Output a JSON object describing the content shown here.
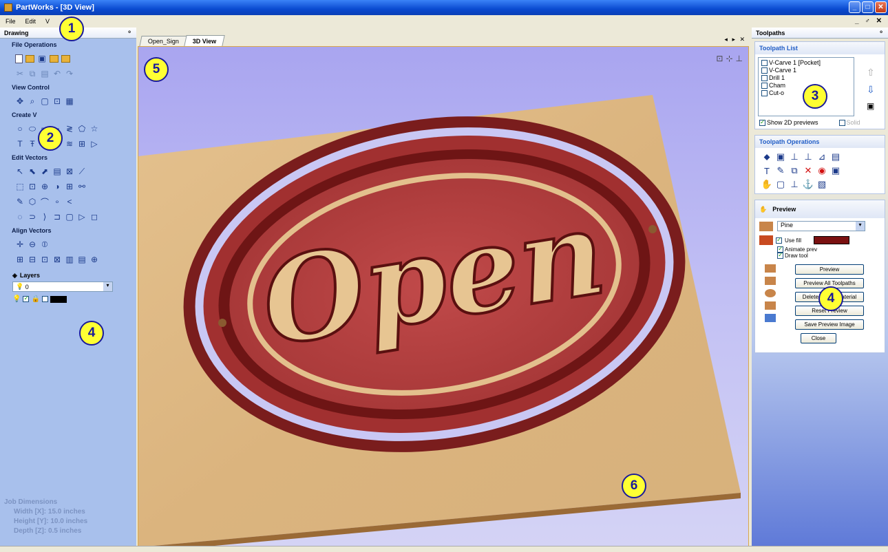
{
  "window": {
    "title": "PartWorks - [3D View]",
    "min": "_",
    "max": "□",
    "close": "✕"
  },
  "menu": {
    "items": [
      "File",
      "Edit",
      "V"
    ],
    "mdi": "_ ♂ ✕"
  },
  "left_panel": {
    "title": "Drawing",
    "pin": "ᵒ",
    "sections": {
      "file_ops": "File Operations",
      "view_control": "View Control",
      "create_vectors": "Create V",
      "edit_vectors": "Edit Vectors",
      "align_vectors": "Align Vectors"
    },
    "layers": {
      "title": "Layers",
      "current": "0"
    },
    "job": {
      "title": "Job Dimensions",
      "width": "Width  [X]: 15.0 inches",
      "height": "Height [Y]: 10.0 inches",
      "depth": "Depth  [Z]: 0.5 inches"
    }
  },
  "tabs": {
    "items": [
      "Open_Sign",
      "3D View"
    ],
    "active": 1,
    "controls": "◂ ▸ ✕"
  },
  "view": {
    "sign_text": "Open",
    "icons": [
      "zoom-extents-icon",
      "axis-xy-icon",
      "axis-z-icon"
    ]
  },
  "right_panel": {
    "title": "Toolpaths",
    "list_title": "Toolpath List",
    "toolpaths": [
      "V-Carve 1 [Pocket]",
      "V-Carve 1",
      "Drill 1",
      "Cham",
      "Cut-o"
    ],
    "show_2d": "Show 2D previews",
    "solid": "Solid",
    "ops_title": "Toolpath Operations",
    "preview": {
      "title": "Preview",
      "material": "Pine",
      "use_fill": "Use fill",
      "fill_color": "#7a1010",
      "animate": "Animate prev",
      "draw_tool": "Draw tool",
      "buttons": [
        "Preview",
        "Preview All Toolpaths",
        "Delete Waste Material",
        "Reset Preview",
        "Save Preview Image"
      ],
      "close": "Close"
    }
  },
  "callouts": [
    "1",
    "2",
    "3",
    "4",
    "4",
    "5",
    "6"
  ],
  "colors": {
    "accent": "#215dc6",
    "board": "#d9b682",
    "carve": "#a33a3a"
  }
}
